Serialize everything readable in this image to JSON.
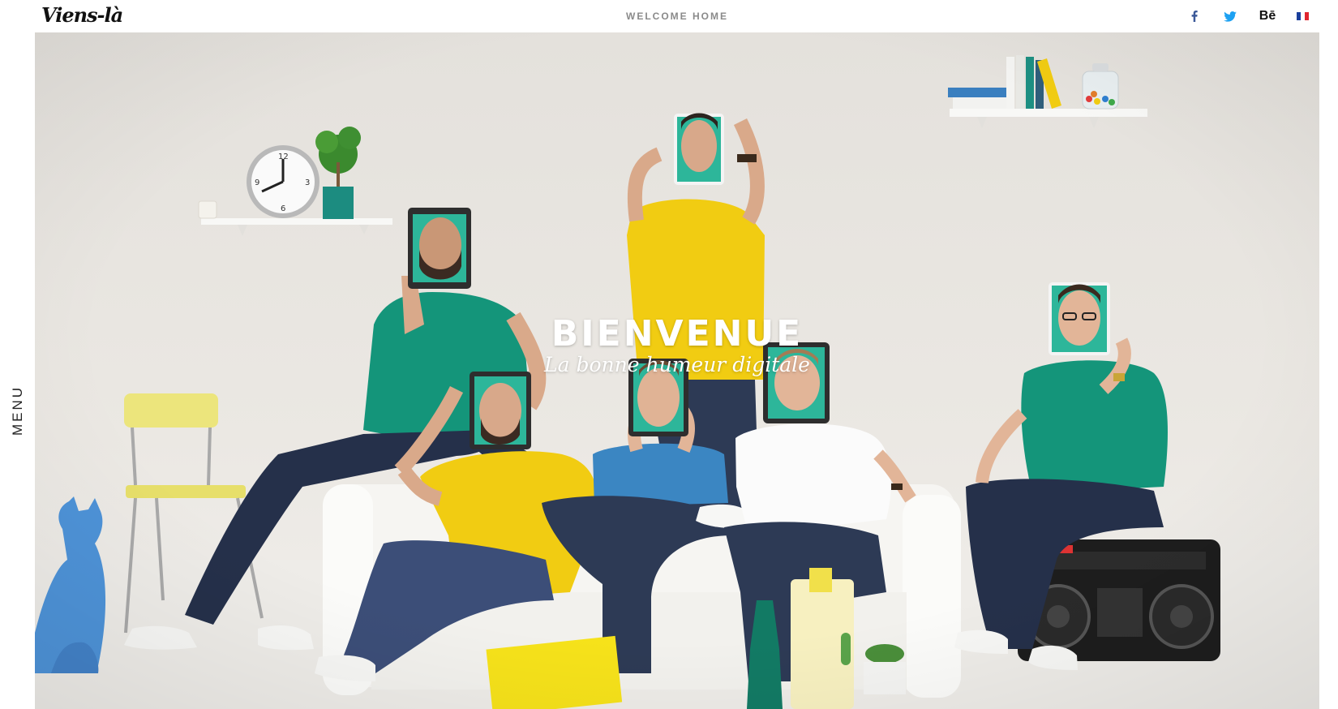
{
  "header": {
    "logo_text": "Viens-là",
    "tagline": "WELCOME HOME",
    "social": [
      {
        "name": "facebook",
        "icon": "facebook-icon"
      },
      {
        "name": "twitter",
        "icon": "twitter-icon"
      },
      {
        "name": "behance",
        "icon": "behance-icon",
        "label": "Bē"
      },
      {
        "name": "language-fr",
        "icon": "french-flag-icon"
      }
    ]
  },
  "side": {
    "menu_label": "MENU"
  },
  "hero": {
    "title": "BIENVENUE",
    "subtitle": "La bonne humeur digitale"
  },
  "colors": {
    "wall": "#e9e6e1",
    "teal": "#14957a",
    "yellow": "#f1cc12",
    "blue_shirt": "#3b86c2",
    "denim": "#2d3a55",
    "cat_blue": "#4e93d8",
    "facebook": "#3b5998",
    "twitter": "#1da1f2"
  }
}
